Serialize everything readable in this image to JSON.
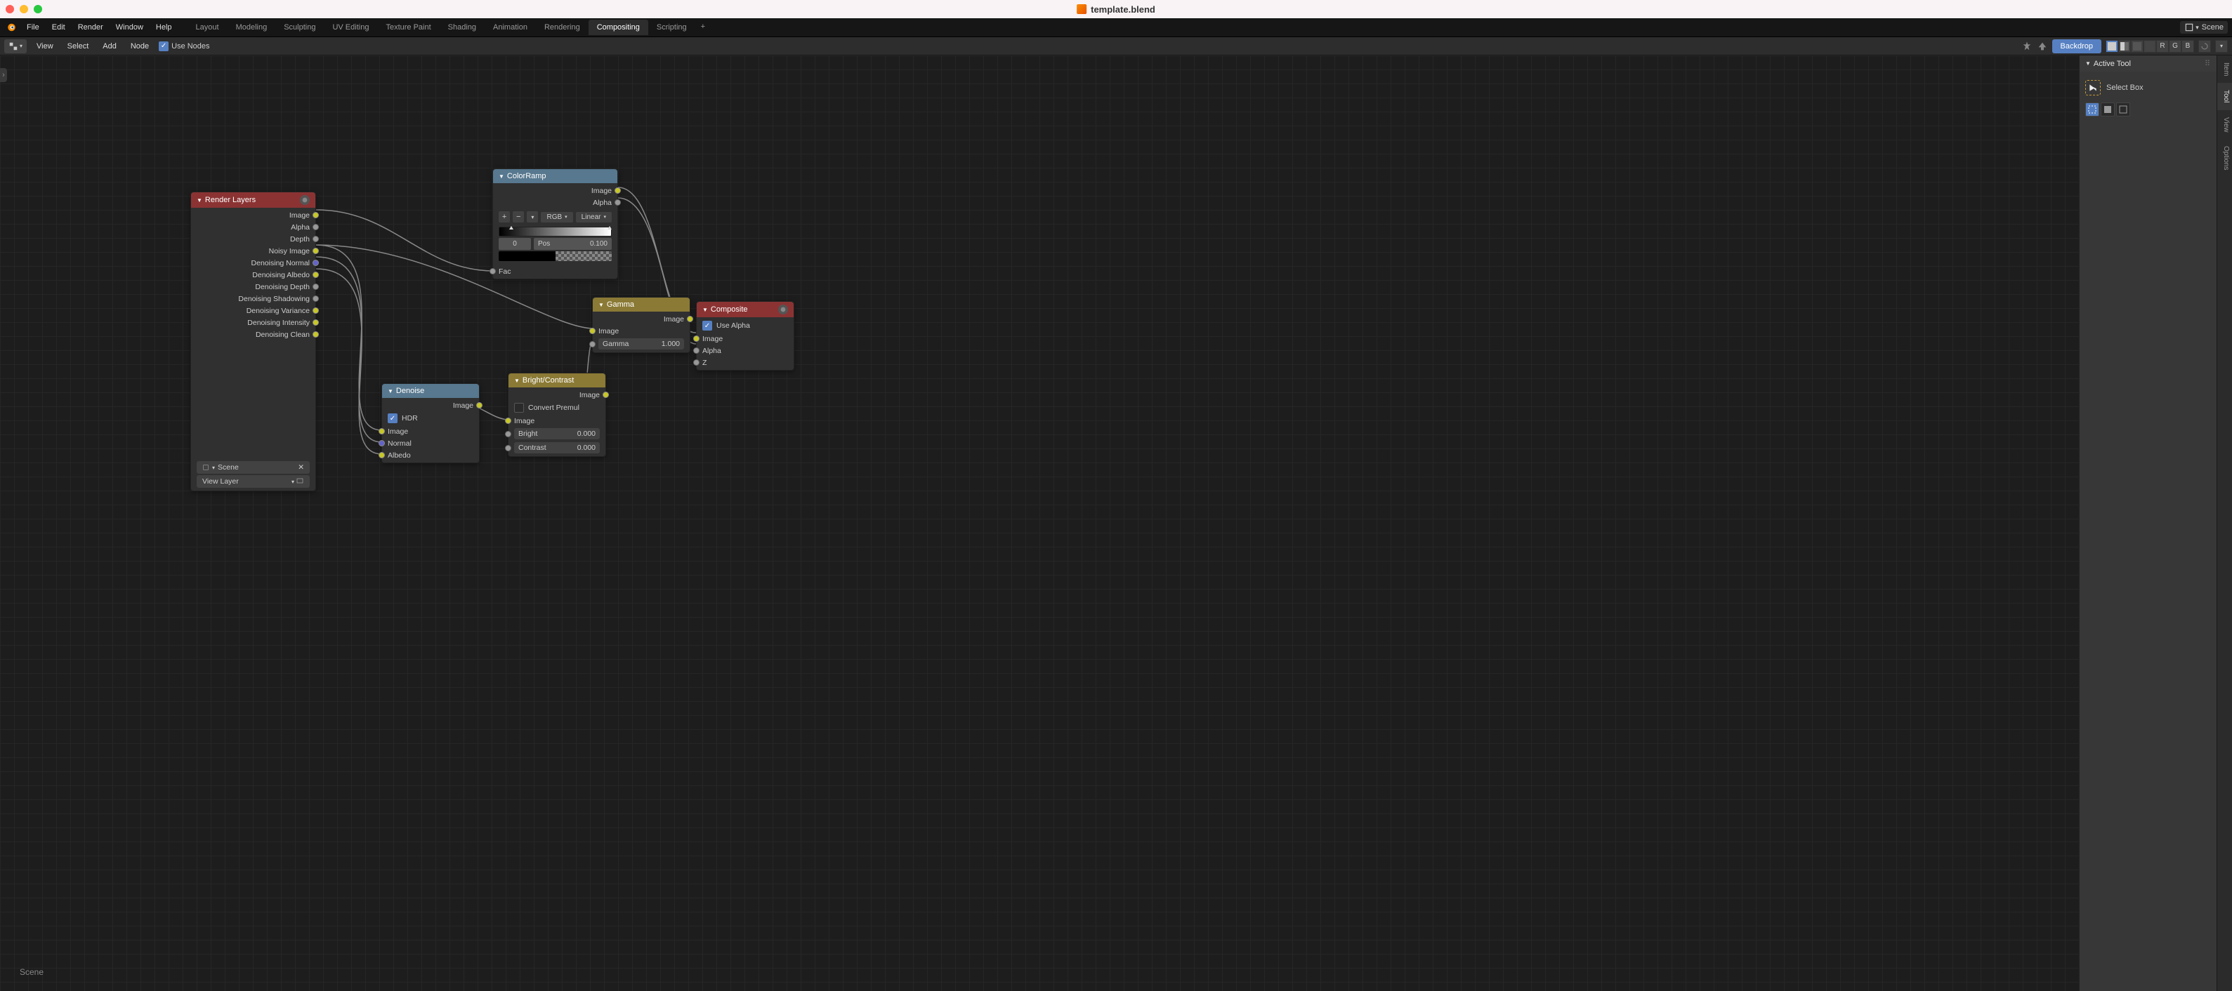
{
  "titlebar": {
    "filename": "template.blend"
  },
  "topmenu": {
    "file": "File",
    "edit": "Edit",
    "render": "Render",
    "window": "Window",
    "help": "Help"
  },
  "workspaces": {
    "tabs": [
      "Layout",
      "Modeling",
      "Sculpting",
      "UV Editing",
      "Texture Paint",
      "Shading",
      "Animation",
      "Rendering",
      "Compositing",
      "Scripting"
    ],
    "active": "Compositing",
    "add": "+"
  },
  "scene_dropdown": {
    "label": "Scene"
  },
  "editor_header": {
    "menus": {
      "view": "View",
      "select": "Select",
      "add": "Add",
      "node": "Node"
    },
    "use_nodes": "Use Nodes",
    "backdrop": "Backdrop",
    "channels": [
      "R",
      "G",
      "B"
    ]
  },
  "nodes": {
    "render_layers": {
      "title": "Render Layers",
      "outputs": [
        "Image",
        "Alpha",
        "Depth",
        "Noisy Image",
        "Denoising Normal",
        "Denoising Albedo",
        "Denoising Depth",
        "Denoising Shadowing",
        "Denoising Variance",
        "Denoising Intensity",
        "Denoising Clean"
      ],
      "scene_field": "Scene",
      "viewlayer_field": "View Layer"
    },
    "colorramp": {
      "title": "ColorRamp",
      "out_image": "Image",
      "out_alpha": "Alpha",
      "mode": "RGB",
      "interp": "Linear",
      "stop_index": "0",
      "pos_label": "Pos",
      "pos_value": "0.100",
      "in_fac": "Fac"
    },
    "gamma": {
      "title": "Gamma",
      "out_image": "Image",
      "in_image": "Image",
      "gamma_label": "Gamma",
      "gamma_value": "1.000"
    },
    "composite": {
      "title": "Composite",
      "use_alpha": "Use Alpha",
      "in_image": "Image",
      "in_alpha": "Alpha",
      "in_z": "Z"
    },
    "denoise": {
      "title": "Denoise",
      "out_image": "Image",
      "hdr": "HDR",
      "in_image": "Image",
      "in_normal": "Normal",
      "in_albedo": "Albedo"
    },
    "brightcontrast": {
      "title": "Bright/Contrast",
      "out_image": "Image",
      "convert_premul": "Convert Premul",
      "in_image": "Image",
      "bright_label": "Bright",
      "bright_value": "0.000",
      "contrast_label": "Contrast",
      "contrast_value": "0.000"
    }
  },
  "breadcrumb": "Scene",
  "npanel": {
    "header": "Active Tool",
    "tool_name": "Select Box"
  },
  "side_tabs": [
    "Item",
    "Tool",
    "View",
    "Options"
  ]
}
